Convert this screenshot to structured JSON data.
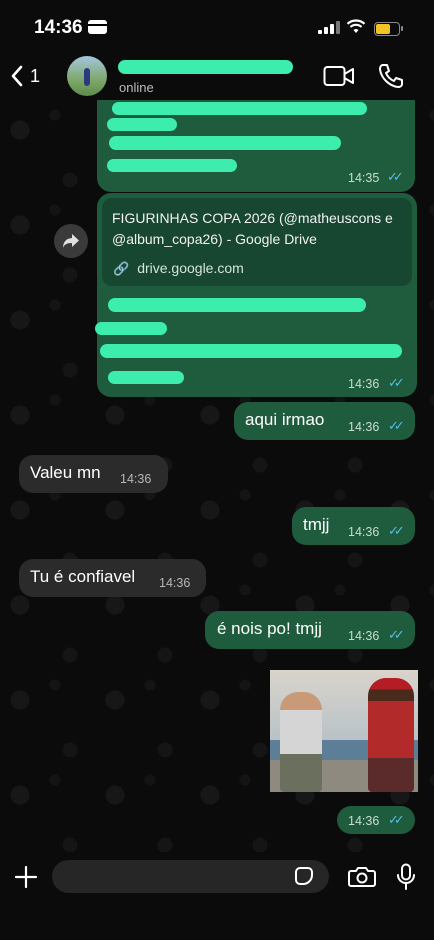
{
  "status_bar": {
    "time": "14:36"
  },
  "header": {
    "back_count": "1",
    "contact_status": "online"
  },
  "messages": [
    {
      "time": "14:35"
    },
    {
      "preview_title": "FIGURINHAS COPA 2026 (@matheuscons e @album_copa26) - Google Drive",
      "preview_domain": "drive.google.com",
      "time": "14:36"
    },
    {
      "text": "aqui irmao",
      "time": "14:36"
    },
    {
      "text": "Valeu mn",
      "time": "14:36"
    },
    {
      "text": "tmjj",
      "time": "14:36"
    },
    {
      "text": "Tu é confiavel",
      "time": "14:36"
    },
    {
      "text": "é nois po! tmjj",
      "time": "14:36"
    },
    {
      "time": "14:36"
    }
  ],
  "colors": {
    "outgoing_bubble": "#1f5c3e",
    "incoming_bubble": "#2b2b2b",
    "read_ticks": "#53bdeb",
    "redaction": "#3dedad",
    "battery": "#f3c524"
  },
  "icons": {
    "back": "chevron-left-icon",
    "video": "video-camera-icon",
    "phone": "phone-icon",
    "forward": "forward-icon",
    "link": "link-icon",
    "plus": "plus-icon",
    "sticker": "sticker-icon",
    "camera": "camera-icon",
    "mic": "microphone-icon"
  }
}
